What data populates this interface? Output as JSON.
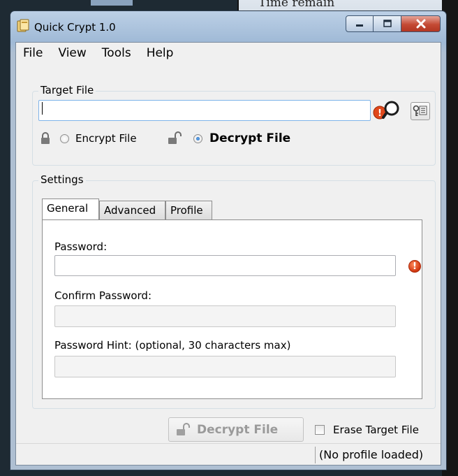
{
  "background": {
    "partial_text": "Time remain"
  },
  "window": {
    "title": "Quick Crypt 1.0",
    "caption_buttons": {
      "minimize_icon": "minimize-icon",
      "maximize_icon": "maximize-icon",
      "close_icon": "close-icon"
    }
  },
  "menu": {
    "items": [
      "File",
      "View",
      "Tools",
      "Help"
    ]
  },
  "target_file": {
    "legend": "Target File",
    "path_value": "",
    "encrypt_label": "Encrypt File",
    "decrypt_label": "Decrypt File",
    "selected_mode": "decrypt"
  },
  "settings": {
    "legend": "Settings",
    "tabs": [
      "General",
      "Advanced",
      "Profile"
    ],
    "active_tab": "General",
    "password_label": "Password:",
    "password_value": "",
    "confirm_label": "Confirm Password:",
    "confirm_value": "",
    "hint_label": "Password Hint: (optional, 30 characters max)",
    "hint_value": ""
  },
  "actions": {
    "decrypt_button_label": "Decrypt File",
    "erase_label": "Erase Target File",
    "erase_checked": false
  },
  "status": {
    "profile_text": "(No profile loaded)"
  },
  "colors": {
    "warning": "#d0360e",
    "close_button": "#c44a34",
    "titlebar": "#bcd0e6"
  }
}
